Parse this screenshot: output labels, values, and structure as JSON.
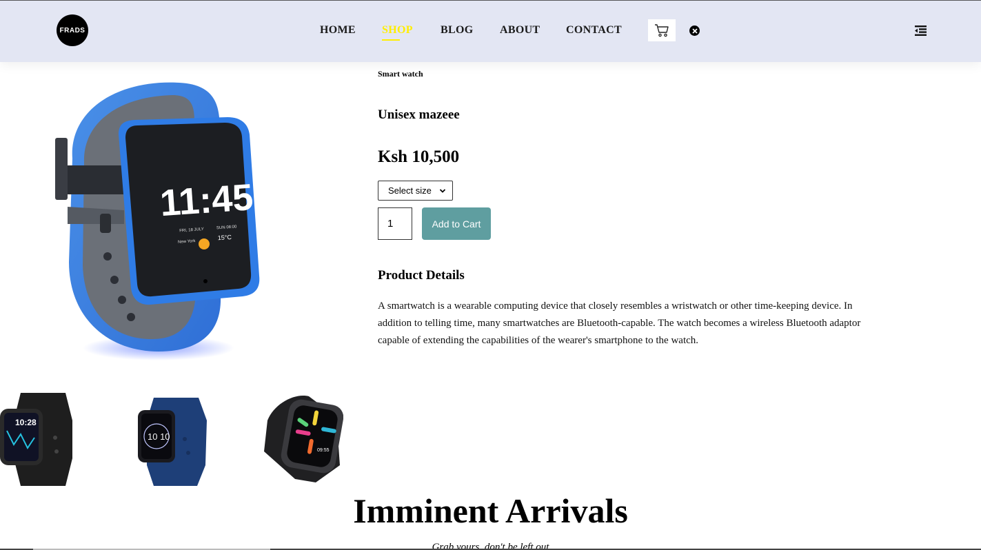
{
  "header": {
    "logo_text": "FRADS",
    "nav": [
      {
        "label": "HOME",
        "active": false
      },
      {
        "label": "SHOP",
        "active": true
      },
      {
        "label": "BLOG",
        "active": false
      },
      {
        "label": "ABOUT",
        "active": false
      },
      {
        "label": "CONTACT",
        "active": false
      }
    ],
    "icons": [
      "cart-icon",
      "close-icon",
      "menu-icon"
    ],
    "colors": {
      "background": "#e3e6f3",
      "active_link": "#ffee00"
    }
  },
  "product": {
    "category": "Smart watch",
    "name": "Unisex mazeee",
    "price": "Ksh 10,500",
    "size_select": {
      "selected": "Select size"
    },
    "quantity": "1",
    "add_to_cart_label": "Add to Cart",
    "details_heading": "Product Details",
    "details_text": "A smartwatch is a wearable computing device that closely resembles a wristwatch or other time-keeping device. In addition to telling time, many smartwatches are Bluetooth-capable. The watch becomes a wireless Bluetooth adaptor capable of extending the capabilities of the wearer's smartphone to the watch.",
    "main_image": {
      "screen_time": "11:45",
      "screen_date": "FRI, 18 JULY",
      "screen_city": "New York",
      "screen_temp": "15°C",
      "screen_sun": "SUN 08:00"
    },
    "thumbnails": [
      {
        "name": "black-smartwatch",
        "screen_time": "10:28"
      },
      {
        "name": "navy-smartwatch",
        "screen_time": "10 10"
      },
      {
        "name": "oppo-smartwatch",
        "screen_time": "09:55"
      }
    ],
    "accent_color": "#5f9ea0"
  },
  "arrivals": {
    "heading": "Imminent Arrivals",
    "subheading": "Grab yours, don't be left out"
  }
}
